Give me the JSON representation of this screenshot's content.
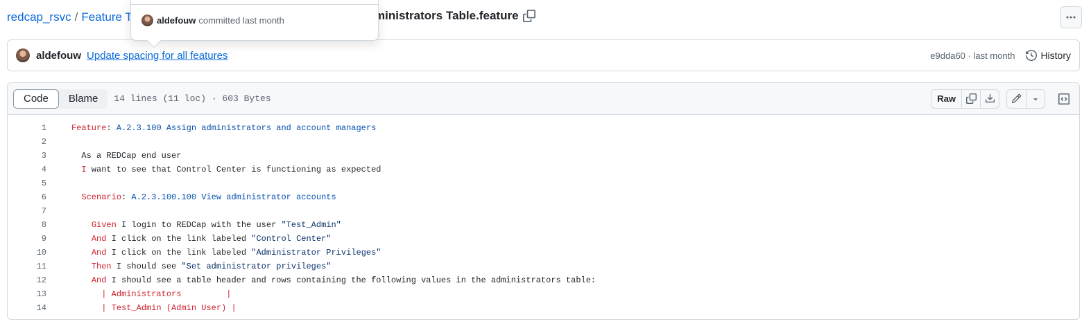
{
  "breadcrumb": {
    "repo": "redcap_rsvc",
    "folder_partial": "Feature Te",
    "file_name": "ministrators Table.feature"
  },
  "popover": {
    "author": "aldefouw",
    "message": "committed last month"
  },
  "commit": {
    "author": "aldefouw",
    "message": "Update spacing for all features",
    "sha_time": "e9dda60 · last month",
    "history_label": "History"
  },
  "file_header": {
    "tab_code": "Code",
    "tab_blame": "Blame",
    "meta": "14 lines (11 loc) · 603 Bytes",
    "raw_label": "Raw"
  },
  "code_lines": [
    {
      "n": "1",
      "parts": [
        [
          "kw",
          "Feature"
        ],
        [
          "plain",
          ": "
        ],
        [
          "ttl",
          "A.2.3.100 Assign administrators and account managers"
        ]
      ]
    },
    {
      "n": "2",
      "parts": []
    },
    {
      "n": "3",
      "parts": [
        [
          "plain",
          "  As a REDCap end user"
        ]
      ]
    },
    {
      "n": "4",
      "parts": [
        [
          "plain",
          "  "
        ],
        [
          "kw",
          "I"
        ],
        [
          "plain",
          " want to see that Control Center is functioning as expected"
        ]
      ]
    },
    {
      "n": "5",
      "parts": []
    },
    {
      "n": "6",
      "parts": [
        [
          "plain",
          "  "
        ],
        [
          "kw",
          "Scenario"
        ],
        [
          "plain",
          ": "
        ],
        [
          "ttl",
          "A.2.3.100.100 View administrator accounts"
        ]
      ]
    },
    {
      "n": "7",
      "parts": []
    },
    {
      "n": "8",
      "parts": [
        [
          "plain",
          "    "
        ],
        [
          "kw",
          "Given"
        ],
        [
          "plain",
          " I login to REDCap with the user "
        ],
        [
          "str",
          "\"Test_Admin\""
        ]
      ]
    },
    {
      "n": "9",
      "parts": [
        [
          "plain",
          "    "
        ],
        [
          "kw",
          "And"
        ],
        [
          "plain",
          " I click on the link labeled "
        ],
        [
          "str",
          "\"Control Center\""
        ]
      ]
    },
    {
      "n": "10",
      "parts": [
        [
          "plain",
          "    "
        ],
        [
          "kw",
          "And"
        ],
        [
          "plain",
          " I click on the link labeled "
        ],
        [
          "str",
          "\"Administrator Privileges\""
        ]
      ]
    },
    {
      "n": "11",
      "parts": [
        [
          "plain",
          "    "
        ],
        [
          "kw",
          "Then"
        ],
        [
          "plain",
          " I should see "
        ],
        [
          "str",
          "\"Set administrator privileges\""
        ]
      ]
    },
    {
      "n": "12",
      "parts": [
        [
          "plain",
          "    "
        ],
        [
          "kw",
          "And"
        ],
        [
          "plain",
          " I should see a table header and rows containing the following values in the administrators table:"
        ]
      ]
    },
    {
      "n": "13",
      "parts": [
        [
          "plain",
          "      "
        ],
        [
          "tbl",
          "| Administrators         |"
        ]
      ]
    },
    {
      "n": "14",
      "parts": [
        [
          "plain",
          "      "
        ],
        [
          "tbl",
          "| Test_Admin (Admin User) |"
        ]
      ]
    }
  ]
}
